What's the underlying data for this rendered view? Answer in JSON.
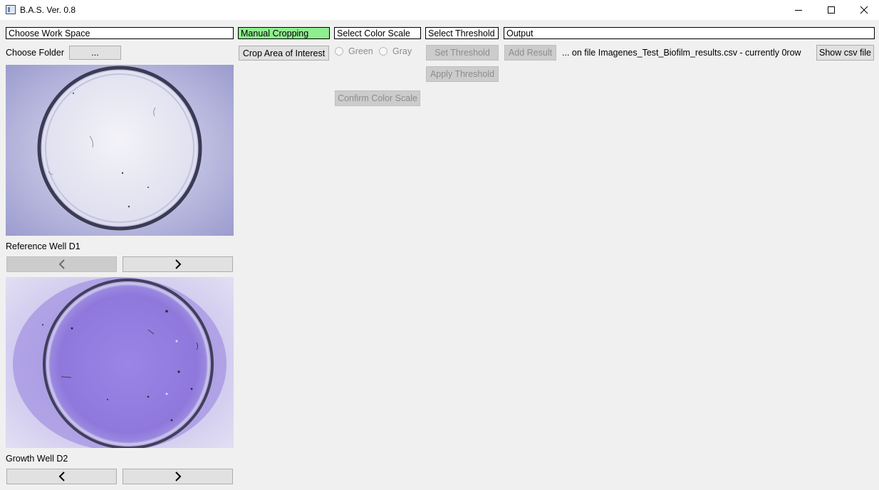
{
  "window": {
    "title": "B.A.S. Ver. 0.8"
  },
  "sections": {
    "work_space": "Choose Work Space",
    "manual_cropping": "Manual Cropping",
    "color_scale": "Select Color Scale",
    "threshold": "Select Threshold",
    "output": "Output"
  },
  "folder": {
    "label": "Choose Folder",
    "button": "..."
  },
  "crop": {
    "button": "Crop Area of Interest"
  },
  "color_scale": {
    "options": [
      "Green",
      "Gray"
    ],
    "confirm": "Confirm Color Scale"
  },
  "threshold": {
    "set": "Set Threshold",
    "apply": "Apply Threshold"
  },
  "output": {
    "add_result": "Add Result",
    "status": "... on file Imagenes_Test_Biofilm_results.csv - currently 0row",
    "show_csv": "Show csv file"
  },
  "wells": {
    "reference": {
      "label": "Reference Well D1"
    },
    "growth": {
      "label": "Growth Well D2"
    }
  },
  "colors": {
    "highlight_green": "#90ee90",
    "reference_well": "#e6e5f2",
    "growth_well": "#9a86e6"
  }
}
